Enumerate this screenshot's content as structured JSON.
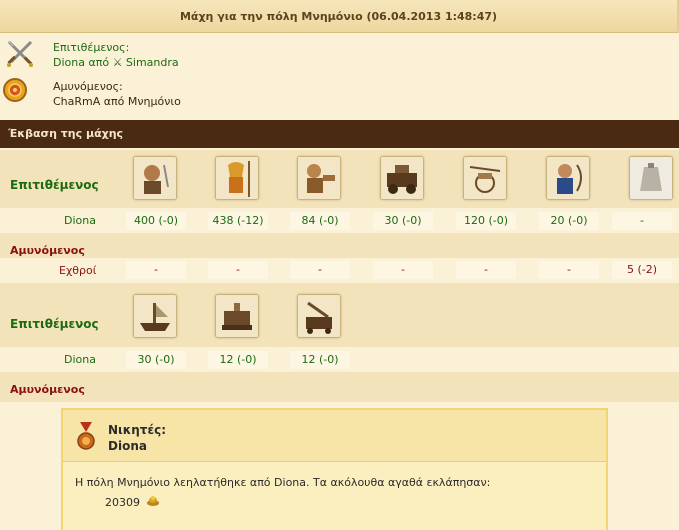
{
  "header": {
    "title": "Μάχη για την πόλη Μνημόνιο (06.04.2013 1:48:47)"
  },
  "attacker": {
    "role_label": "Επιτιθέμενος:",
    "name_line": "Diona από ⚔ Simandra"
  },
  "defender": {
    "role_label": "Αμυνόμενος:",
    "name_line": "ChaRmA από Μνημόνιο"
  },
  "outcome_title": "Έκβαση της μάχης",
  "land_battle": {
    "attacker_label": "Επιτιθέμενος",
    "attacker_name": "Diona",
    "attacker_units": [
      {
        "icon": "swordsman-icon",
        "count": "400 (-0)"
      },
      {
        "icon": "hoplite-icon",
        "count": "438 (-12)"
      },
      {
        "icon": "slinger-icon",
        "count": "84 (-0)"
      },
      {
        "icon": "catapult-icon",
        "count": "30 (-0)"
      },
      {
        "icon": "chariot-icon",
        "count": "120 (-0)"
      },
      {
        "icon": "archer-icon",
        "count": "20 (-0)"
      },
      {
        "icon": "militia-icon",
        "count": "-"
      }
    ],
    "defender_label": "Αμυνόμενος",
    "defender_name": "Εχθροί",
    "defender_counts": [
      "-",
      "-",
      "-",
      "-",
      "-",
      "-",
      "5 (-2)"
    ]
  },
  "naval_battle": {
    "attacker_label": "Επιτιθέμενος",
    "attacker_name": "Diona",
    "attacker_units": [
      {
        "icon": "fire-ship-icon",
        "count": "30 (-0)"
      },
      {
        "icon": "transport-ship-icon",
        "count": "12 (-0)"
      },
      {
        "icon": "colony-ship-icon",
        "count": "12 (-0)"
      }
    ],
    "defender_label": "Αμυνόμενος"
  },
  "result": {
    "winners_label": "Νικητές:",
    "winner": "Diona",
    "loot_text": "Η πόλη Μνημόνιο λεηλατήθηκε από Diona. Τα ακόλουθα αγαθά εκλάπησαν:",
    "loot_amount": "20309",
    "loot_icon": "gold-pile-icon"
  }
}
